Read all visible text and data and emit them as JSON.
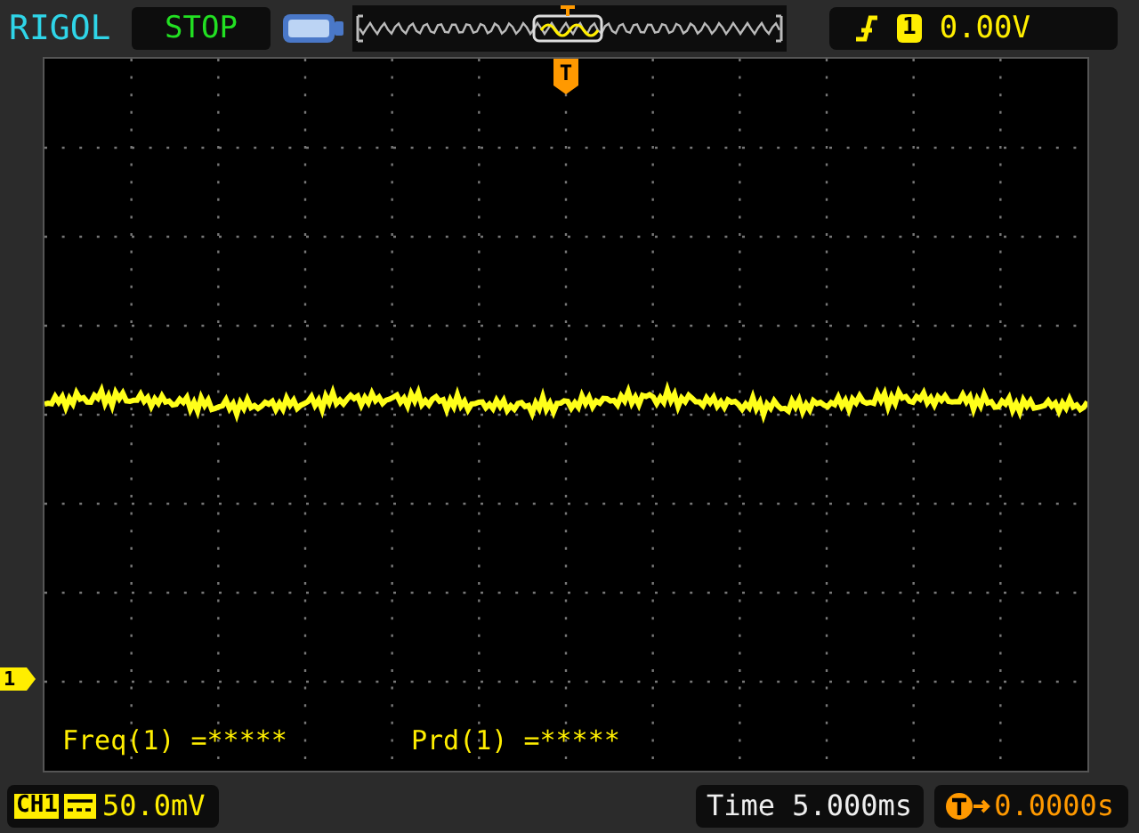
{
  "brand": "RIGOL",
  "run_state": "STOP",
  "trigger": {
    "source": "1",
    "level": "0.00V",
    "marker": "T"
  },
  "channel_marker": "1",
  "measurements": [
    {
      "label": "Freq(1) =*****"
    },
    {
      "label": "Prd(1) =*****"
    }
  ],
  "status_bar": {
    "channel": "CH1",
    "scale": "50.0mV",
    "timebase": "Time 5.000ms",
    "offset": "0.0000s"
  }
}
